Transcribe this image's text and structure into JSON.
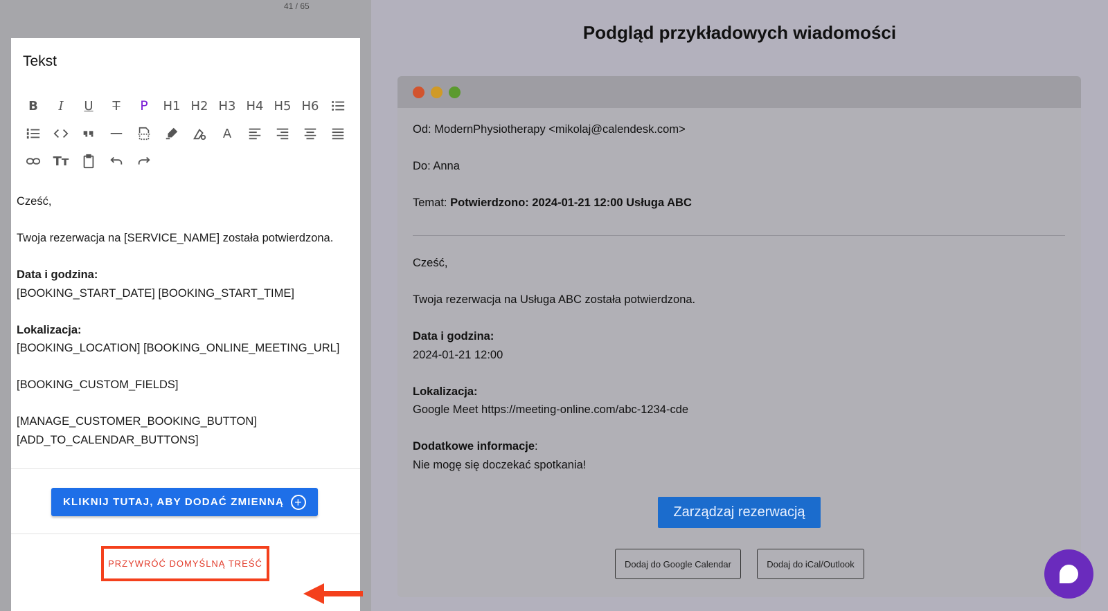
{
  "page_counter": "41 / 65",
  "editor": {
    "title": "Tekst",
    "toolbar": {
      "row1": [
        "B",
        "I",
        "U",
        "S",
        "P",
        "H1",
        "H2",
        "H3",
        "H4",
        "H5",
        "H6",
        "bullet-list-icon"
      ],
      "heading_labels": [
        "H1",
        "H2",
        "H3",
        "H4",
        "H5",
        "H6"
      ],
      "paragraph_label": "P"
    },
    "body": {
      "greeting": "Cześć,",
      "line1": "Twoja rezerwacja na [SERVICE_NAME] została potwierdzona.",
      "date_label": "Data i godzina:",
      "date_value": "[BOOKING_START_DATE] [BOOKING_START_TIME]",
      "location_label": "Lokalizacja:",
      "location_value": "[BOOKING_LOCATION] [BOOKING_ONLINE_MEETING_URL]",
      "custom_fields": "[BOOKING_CUSTOM_FIELDS]",
      "manage_button": "[MANAGE_CUSTOMER_BOOKING_BUTTON]",
      "calendar_buttons": "[ADD_TO_CALENDAR_BUTTONS]"
    },
    "add_variable_label": "KLIKNIJ TUTAJ, ABY DODAĆ ZMIENNĄ",
    "reset_label": "PRZYWRÓĆ DOMYŚLNĄ TREŚĆ"
  },
  "preview": {
    "title": "Podgląd przykładowych wiadomości",
    "from_label": "Od:",
    "from_value": "ModernPhysiotherapy <mikolaj@calendesk.com>",
    "to_label": "Do:",
    "to_value": "Anna",
    "subject_label": "Temat:",
    "subject_value": "Potwierdzono: 2024-01-21 12:00 Usługa ABC",
    "greeting": "Cześć,",
    "line1": "Twoja rezerwacja na Usługa ABC została potwierdzona.",
    "date_label": "Data i godzina:",
    "date_value": "2024-01-21 12:00",
    "location_label": "Lokalizacja:",
    "location_value": "Google Meet https://meeting-online.com/abc-1234-cde",
    "extra_label": "Dodatkowe informacje",
    "extra_colon": ":",
    "extra_value": "Nie mogę się doczekać spotkania!",
    "manage_button": "Zarządzaj rezerwacją",
    "google_button": "Dodaj do Google Calendar",
    "ical_button": "Dodaj do iCal/Outlook"
  },
  "colors": {
    "primary_button": "#1e6fe8",
    "reset_highlight": "#f4401c",
    "traffic_red": "#d2542e",
    "traffic_yellow": "#d09a26",
    "traffic_green": "#5b9a2e",
    "chat_bubble": "#6a2bbd"
  }
}
